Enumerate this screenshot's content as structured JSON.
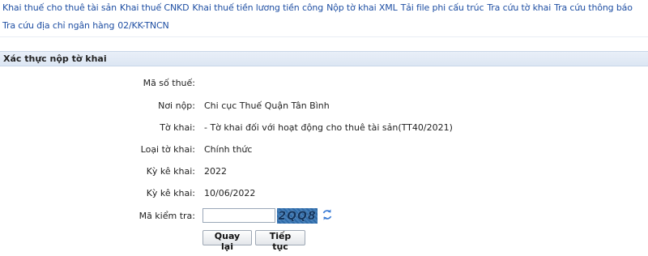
{
  "menu": {
    "row1": [
      "Khai thuế cho thuê tài sản",
      "Khai thuế CNKD",
      "Khai thuế tiền lương tiền công",
      "Nộp tờ khai XML",
      "Tải file phi cấu trúc",
      "Tra cứu tờ khai",
      "Tra cứu thông báo"
    ],
    "row2": [
      "Tra cứu địa chỉ ngân hàng",
      "02/KK-TNCN"
    ]
  },
  "section": {
    "title": "Xác thực nộp tờ khai"
  },
  "form": {
    "tax_code": {
      "label": "Mã số thuế:",
      "value": ""
    },
    "place": {
      "label": "Nơi nộp:",
      "value": "Chi cục Thuế Quận Tân Bình"
    },
    "declaration": {
      "label": "Tờ khai:",
      "value": " - Tờ khai đối với hoạt động cho thuê tài sản(TT40/2021)"
    },
    "type": {
      "label": "Loại tờ khai:",
      "value": "Chính thức"
    },
    "period1": {
      "label": "Kỳ kê khai:",
      "value": "2022"
    },
    "period2": {
      "label": "Kỳ kê khai:",
      "value": "10/06/2022"
    },
    "captcha": {
      "label": "Mã kiểm tra:",
      "value": "",
      "image_text": "2QQ8"
    }
  },
  "buttons": {
    "back": "Quay lại",
    "next": "Tiếp tục"
  },
  "icons": {
    "refresh": "refresh-icon"
  }
}
